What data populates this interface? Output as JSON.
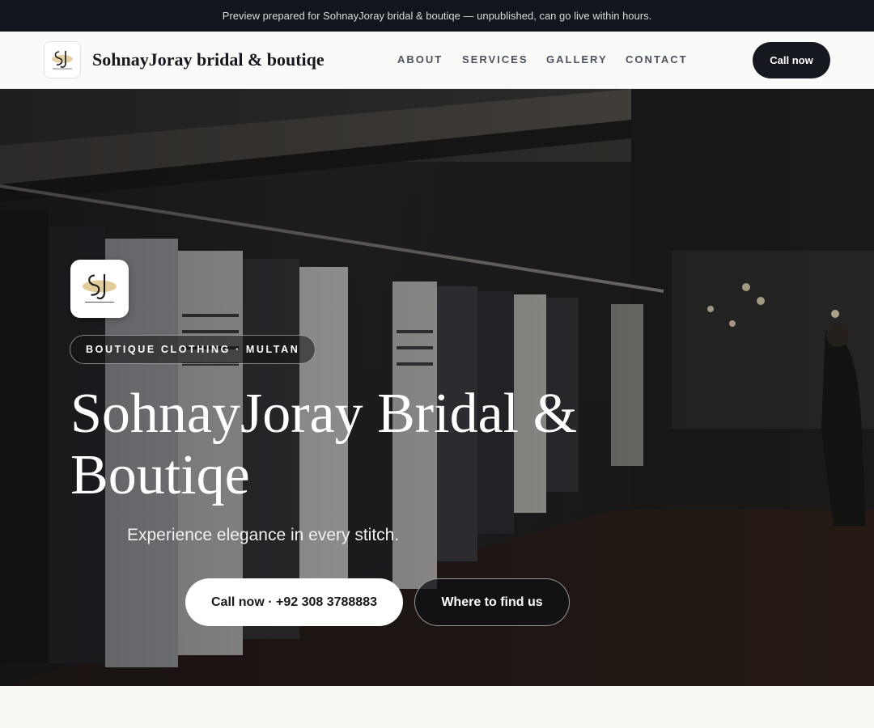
{
  "banner": {
    "text": "Preview prepared for SohnayJoray bridal & boutiqe — unpublished, can go live within hours."
  },
  "header": {
    "brand": "SohnayJoray bridal & boutiqe",
    "logo_icon": "sj-monogram-logo",
    "nav": [
      {
        "label": "ABOUT"
      },
      {
        "label": "SERVICES"
      },
      {
        "label": "GALLERY"
      },
      {
        "label": "CONTACT"
      }
    ],
    "call_label": "Call now"
  },
  "hero": {
    "background": "boutique-clothing-racks-photo",
    "logo_icon": "sj-monogram-logo",
    "tag": "BOUTIQUE CLOTHING · MULTAN",
    "title": "SohnayJoray Bridal & Boutiqe",
    "subtitle": "Experience elegance in every stitch.",
    "primary_cta": "Call now · +92 308 3788883",
    "secondary_cta": "Where to find us"
  },
  "colors": {
    "banner_bg": "#11151c",
    "header_bg": "#fafaf8",
    "dark_button": "#15181e",
    "page_bg": "#f8f7f4",
    "logo_gold": "#c9a24a"
  }
}
